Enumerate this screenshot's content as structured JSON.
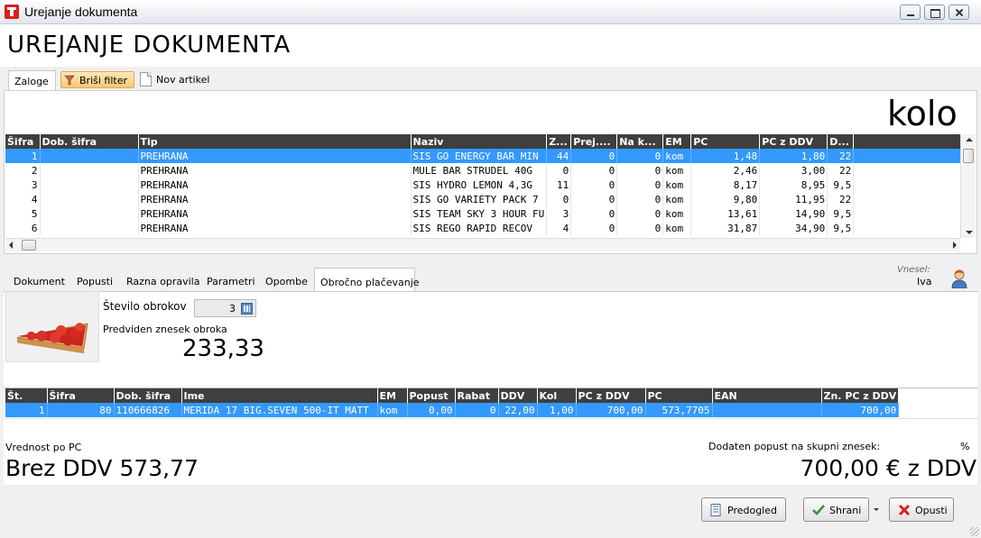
{
  "window": {
    "title": "Urejanje dokumenta"
  },
  "page_title": "UREJANJE DOKUMENTA",
  "toolbar": {
    "tab_label": "Zaloge",
    "clear_filter_label": "Briši filter",
    "new_article_label": "Nov artikel"
  },
  "search": {
    "value": "kolo"
  },
  "stock_table": {
    "headers": [
      "Šifra",
      "Dob. šifra",
      "Tip",
      "Naziv",
      "Z...",
      "Prej....",
      "Na k...",
      "EM",
      "PC",
      "PC z DDV",
      "D..."
    ],
    "rows": [
      [
        "1",
        "",
        "PREHRANA",
        "SIS GO ENERGY BAR MIN",
        "44",
        "0",
        "0",
        "kom",
        "1,48",
        "1,80",
        "22"
      ],
      [
        "2",
        "",
        "PREHRANA",
        "MULE BAR STRUDEL 40G",
        "0",
        "0",
        "0",
        "kom",
        "2,46",
        "3,00",
        "22"
      ],
      [
        "3",
        "",
        "PREHRANA",
        "SIS HYDRO LEMON 4,3G",
        "11",
        "0",
        "0",
        "kom",
        "8,17",
        "8,95",
        "9,5"
      ],
      [
        "4",
        "",
        "PREHRANA",
        "SIS GO VARIETY PACK 7",
        "0",
        "0",
        "0",
        "kom",
        "9,80",
        "11,95",
        "22"
      ],
      [
        "5",
        "",
        "PREHRANA",
        "SIS TEAM SKY 3 HOUR FU",
        "3",
        "0",
        "0",
        "kom",
        "13,61",
        "14,90",
        "9,5"
      ],
      [
        "6",
        "",
        "PREHRANA",
        "SIS REGO RAPID RECOV",
        "4",
        "0",
        "0",
        "kom",
        "31,87",
        "34,90",
        "9,5"
      ]
    ],
    "selected_row": 0
  },
  "detail_tabs": [
    "Dokument",
    "Popusti",
    "Razna opravila",
    "Parametri",
    "Opombe",
    "Obročno plačevanje"
  ],
  "active_detail_tab": 5,
  "vnesel": {
    "label": "Vnesel:",
    "value": "Iva"
  },
  "installments": {
    "count_label": "Število obrokov",
    "count_value": "3",
    "amount_label": "Predviden znesek obroka",
    "amount_value": "233,33"
  },
  "items_table": {
    "headers": [
      "Št.",
      "Šifra",
      "Dob. šifra",
      "Ime",
      "EM",
      "Popust",
      "Rabat",
      "DDV",
      "Kol",
      "PC z DDV",
      "PC",
      "EAN",
      "Zn. PC z DDV"
    ],
    "rows": [
      [
        "1",
        "80",
        "110666826",
        "MERIDA 17 BIG.SEVEN 500-IT MATT",
        "kom",
        "0,00",
        "0",
        "22,00",
        "1,00",
        "700,00",
        "573,7705",
        "",
        "700,00"
      ]
    ]
  },
  "totals": {
    "value_label": "Vrednost po PC",
    "value_text": "Brez DDV 573,77",
    "extra_discount_label": "Dodaten popust na skupni znesek:",
    "percent_sign": "%",
    "total_text": "700,00 € z DDV"
  },
  "footer": {
    "preview_label": "Predogled",
    "save_label": "Shrani",
    "cancel_label": "Opusti"
  },
  "colors": {
    "selection": "#3399ff",
    "header_bg": "#3f3f3f",
    "app_icon": "#d8201c"
  }
}
